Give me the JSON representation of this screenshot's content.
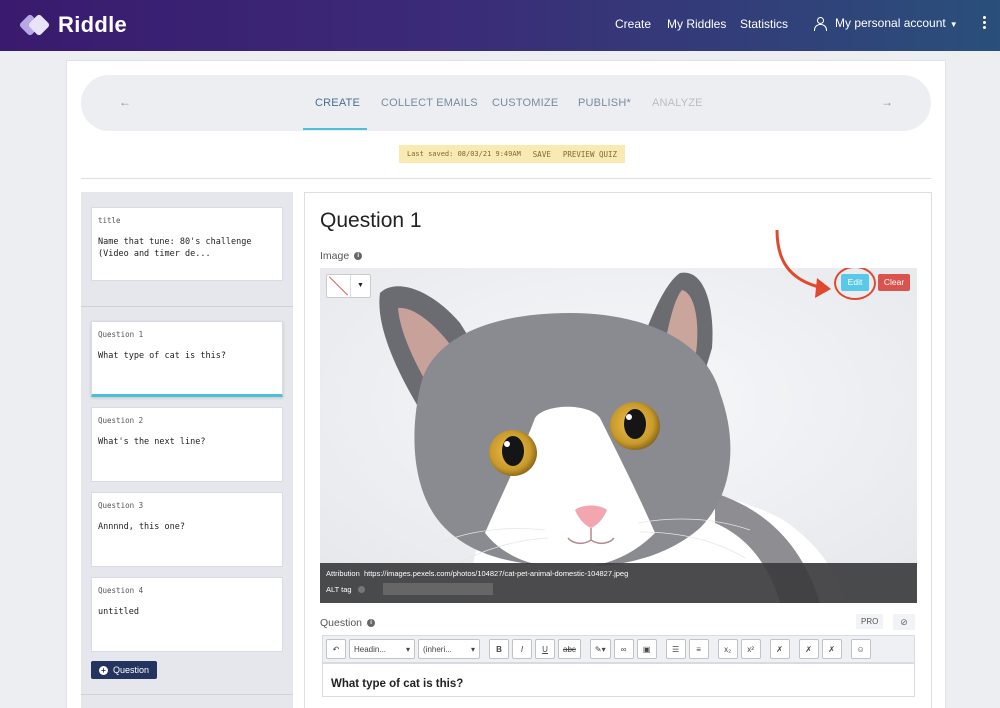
{
  "app": {
    "name": "Riddle"
  },
  "nav": {
    "create": "Create",
    "my_riddles": "My Riddles",
    "statistics": "Statistics",
    "account": "My personal account"
  },
  "steps": {
    "create": "CREATE",
    "collect_emails": "COLLECT EMAILS",
    "customize": "CUSTOMIZE",
    "publish": "PUBLISH*",
    "analyze": "ANALYZE"
  },
  "savebar": {
    "last_saved": "Last saved: 08/03/21 9:49AM",
    "save": "SAVE",
    "preview": "PREVIEW QUIZ"
  },
  "sidebar": {
    "title_card": {
      "label": "title",
      "text": "Name that tune: 80's challenge (Video and timer de..."
    },
    "questions": [
      {
        "label": "Question 1",
        "text": "What type of cat is this?"
      },
      {
        "label": "Question 2",
        "text": "What's the next line?"
      },
      {
        "label": "Question 3",
        "text": "Annnnd, this one?"
      },
      {
        "label": "Question 4",
        "text": "untitled"
      }
    ],
    "add_question": "Question"
  },
  "editor": {
    "title": "Question 1",
    "image_label": "Image",
    "edit": "Edit",
    "clear": "Clear",
    "attribution_label": "Attribution",
    "attribution_url": "https://images.pexels.com/photos/104827/cat-pet-animal-domestic-104827.jpeg",
    "alt_tag_label": "ALT tag",
    "question_label": "Question",
    "pro": "PRO",
    "heading_select": "Headin...",
    "font_select": "(inheri...",
    "question_text": "What type of cat is this?"
  },
  "colors": {
    "accent": "#4cbfd9",
    "danger": "#d9534f",
    "edit": "#5ac8e8",
    "annotation": "#e0492e"
  },
  "icons": [
    "info-icon",
    "user-icon",
    "chevron-left-icon",
    "chevron-right-icon",
    "kebab-menu-icon",
    "plus-icon",
    "undo-icon",
    "bold-icon",
    "italic-icon",
    "underline-icon",
    "strikethrough-icon",
    "link-icon",
    "image-icon",
    "bullet-list-icon",
    "numbered-list-icon",
    "subscript-icon",
    "superscript-icon",
    "clear-format-icon",
    "emoji-icon",
    "check-icon"
  ]
}
